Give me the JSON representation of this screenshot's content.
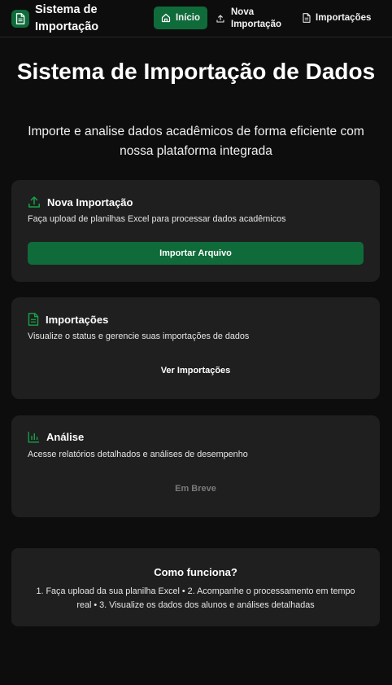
{
  "header": {
    "brand_title": "Sistema de Importação",
    "nav": {
      "home_label": "Início",
      "new_import_label": "Nova Importação",
      "imports_label": "Importações"
    }
  },
  "hero": {
    "title": "Sistema de Importação de Dados",
    "subtitle": "Importe e analise dados acadêmicos de forma eficiente com nossa plataforma integrada"
  },
  "cards": {
    "new_import": {
      "title": "Nova Importação",
      "description": "Faça upload de planilhas Excel para processar dados acadêmicos",
      "button": "Importar Arquivo",
      "icon": "upload-icon"
    },
    "imports": {
      "title": "Importações",
      "description": "Visualize o status e gerencie suas importações de dados",
      "button": "Ver Importações",
      "icon": "document-icon"
    },
    "analysis": {
      "title": "Análise",
      "description": "Acesse relatórios detalhados e análises de desempenho",
      "button": "Em Breve",
      "icon": "bar-chart-icon"
    }
  },
  "how_it_works": {
    "title": "Como funciona?",
    "text": "1. Faça upload da sua planilha Excel • 2. Acompanhe o processamento em tempo real • 3. Visualize os dados dos alunos e análises detalhadas"
  },
  "colors": {
    "background": "#0d0d0d",
    "card": "#1f1f1f",
    "accent": "#0f6b3a",
    "icon_accent": "#16a34a"
  }
}
